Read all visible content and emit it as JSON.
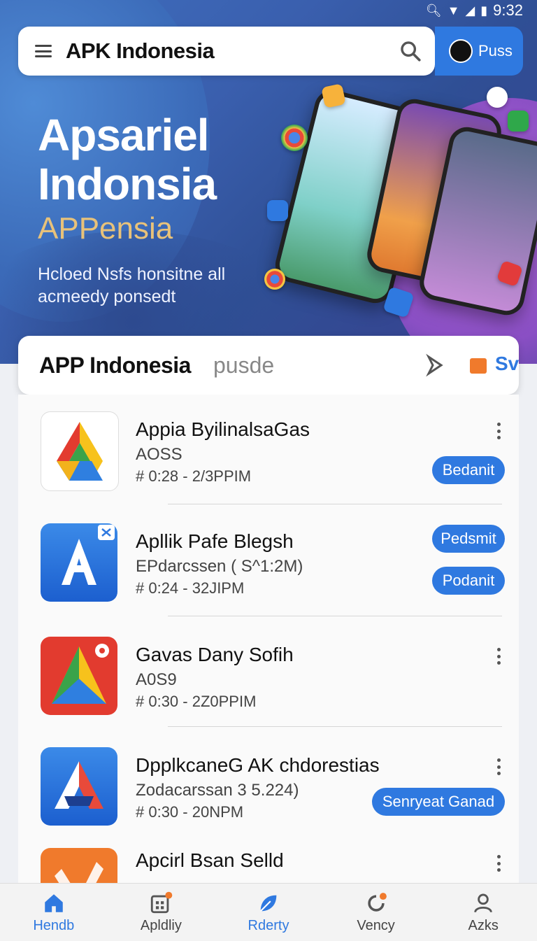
{
  "status": {
    "time": "9:32"
  },
  "topbar": {
    "title": "APK Indonesia",
    "profile_label": "Puss"
  },
  "hero": {
    "title_line1": "Apsariel",
    "title_line2": "Indonsia",
    "subtitle": "APPensia",
    "desc_line1": "Hcloed Nsfs honsitne all",
    "desc_line2": "acmeedy ponsedt"
  },
  "tabs": {
    "primary": "APP Indonesia",
    "secondary": "pusde",
    "right_label": "Sv"
  },
  "apps": [
    {
      "name": "Appia ByilinalsaGas",
      "sub": "AOSS",
      "time": "# 0:28 - 2/3PPIM",
      "buttons": [
        "Bedanit"
      ]
    },
    {
      "name": "Apllik Pafe Blegsh",
      "sub": "EPdarcssen ( S^1:2M)",
      "time": "# 0:24 - 32JIPM",
      "buttons": [
        "Pedsmit",
        "Podanit"
      ]
    },
    {
      "name": "Gavas Dany Sofih",
      "sub": "A0S9",
      "time": "# 0:30 - 2Z0PPIM",
      "buttons": []
    },
    {
      "name": "DpplkcaneG AK chdorestias",
      "sub": "Zodacarssan 3 5.224)",
      "time": "# 0:30 - 20NPM",
      "buttons": [
        "Senryeat Ganad"
      ]
    },
    {
      "name": "Apcirl Bsan Selld",
      "sub": "",
      "time": "",
      "buttons": []
    }
  ],
  "nav": [
    {
      "label": "Hendb",
      "icon": "home-icon"
    },
    {
      "label": "Apldliy",
      "icon": "calendar-icon"
    },
    {
      "label": "Rderty",
      "icon": "leaf-icon"
    },
    {
      "label": "Vency",
      "icon": "refresh-icon"
    },
    {
      "label": "Azks",
      "icon": "user-icon"
    }
  ],
  "colors": {
    "accent": "#2f79e0",
    "hero_gold": "#e8c27a"
  }
}
